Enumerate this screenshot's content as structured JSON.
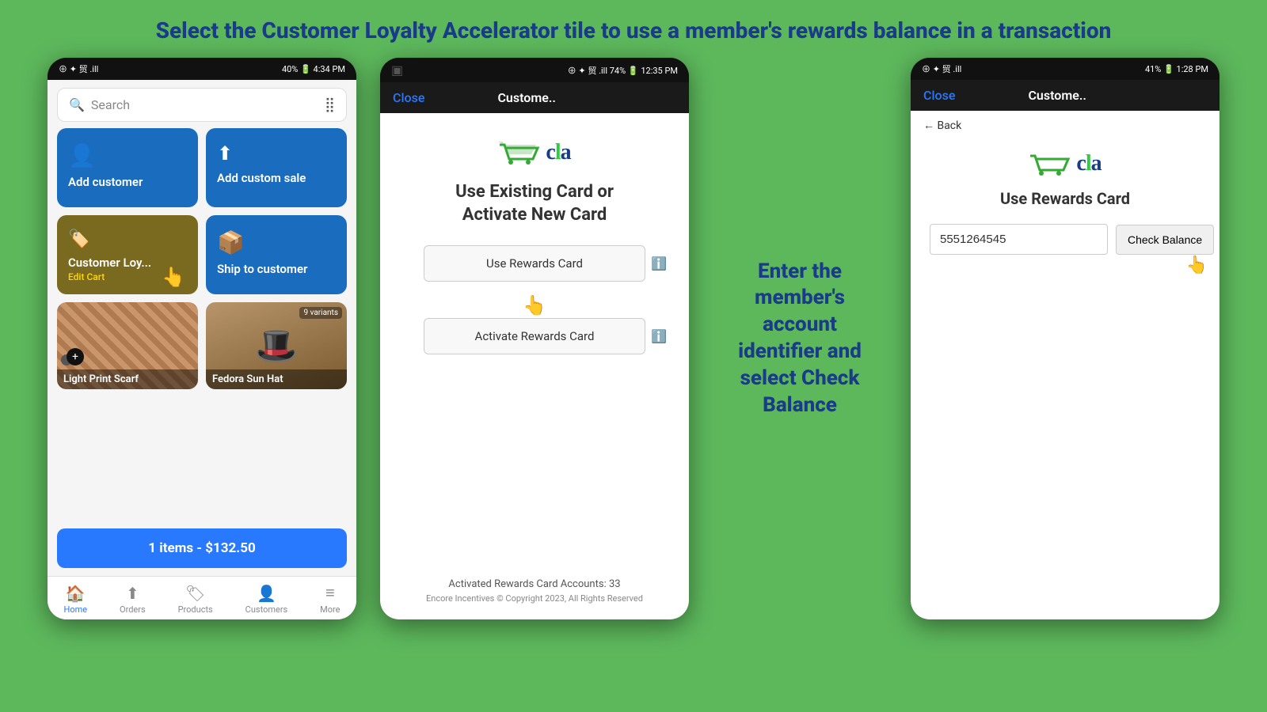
{
  "page": {
    "title": "Select the Customer Loyalty Accelerator tile to use a member's rewards balance in a transaction"
  },
  "phone1": {
    "status_bar": {
      "left": "⊕ ✦ 贸",
      "signal": "40%",
      "time": "4:34 PM",
      "battery": "🔋"
    },
    "search": {
      "placeholder": "Search",
      "barcode_icon": "⣿"
    },
    "tiles": [
      {
        "id": "add-customer",
        "label": "Add customer",
        "icon": "👤",
        "color": "blue"
      },
      {
        "id": "add-custom-sale",
        "label": "Add custom sale",
        "icon": "⬆",
        "color": "blue"
      },
      {
        "id": "customer-loyalty",
        "label": "Customer Loy...",
        "sublabel": "Edit Cart",
        "icon": "🏷",
        "color": "olive",
        "has_cursor": true
      },
      {
        "id": "ship-to-customer",
        "label": "Ship to customer",
        "icon": "📦",
        "color": "blue"
      }
    ],
    "products": [
      {
        "id": "light-print-scarf",
        "label": "Light Print Scarf",
        "type": "scarf"
      },
      {
        "id": "fedora-sun-hat",
        "label": "Fedora Sun Hat",
        "type": "hat",
        "variant": "9 variants"
      }
    ],
    "cart": {
      "label": "1 items - $132.50"
    },
    "nav": [
      {
        "id": "home",
        "label": "Home",
        "icon": "🏠",
        "active": true
      },
      {
        "id": "orders",
        "label": "Orders",
        "icon": "⬆"
      },
      {
        "id": "products",
        "label": "Products",
        "icon": "🏷"
      },
      {
        "id": "customers",
        "label": "Customers",
        "icon": "👤"
      },
      {
        "id": "more",
        "label": "More",
        "icon": "≡"
      }
    ]
  },
  "phone2": {
    "status_bar": {
      "signal": "74%",
      "time": "12:35 PM"
    },
    "header": {
      "close_label": "Close",
      "title": "Custome.."
    },
    "logo_text": "cla",
    "card_title": "Use Existing Card or\nActivate New Card",
    "buttons": [
      {
        "id": "use-rewards-card",
        "label": "Use Rewards Card",
        "has_cursor": true
      },
      {
        "id": "activate-rewards-card",
        "label": "Activate Rewards Card"
      }
    ],
    "accounts_text": "Activated Rewards Card Accounts: 33",
    "copyright": "Encore Incentives © Copyright 2023, All Rights Reserved"
  },
  "annotation": {
    "text": "Enter the\nmember's\naccount\nidentifier and\nselect Check\nBalance"
  },
  "phone3": {
    "status_bar": {
      "signal": "41%",
      "time": "1:28 PM"
    },
    "header": {
      "close_label": "Close",
      "title": "Custome.."
    },
    "back_label": "← Back",
    "logo_text": "cla",
    "section_title": "Use Rewards Card",
    "input_value": "5551264545",
    "check_balance_label": "Check Balance"
  }
}
